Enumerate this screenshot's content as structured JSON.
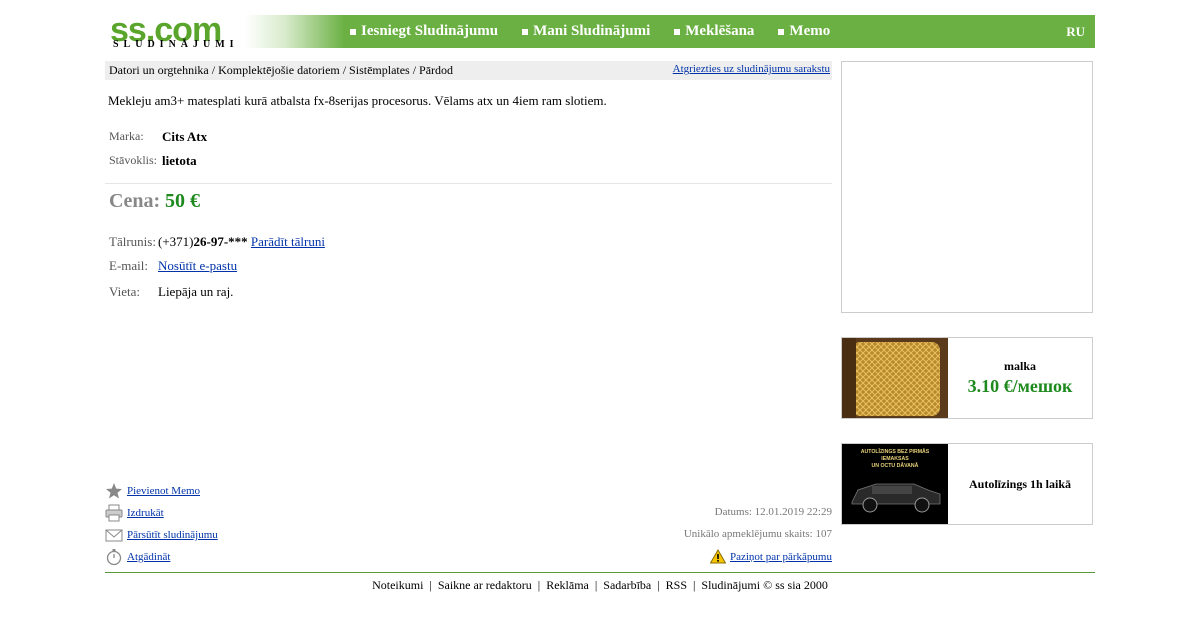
{
  "logo": {
    "main": "ss.com",
    "sub": "SLUDINĀJUMI"
  },
  "nav": [
    {
      "label": "Iesniegt Sludinājumu"
    },
    {
      "label": "Mani Sludinājumi"
    },
    {
      "label": "Meklēšana"
    },
    {
      "label": "Memo"
    }
  ],
  "lang": "RU",
  "breadcrumb": "Datori un orgtehnika / Komplektējošie datoriem / Sistēmplates / Pārdod",
  "back_link": "Atgriezties uz sludinājumu sarakstu",
  "description": "Mekleju am3+ matesplati kurā atbalsta fx-8serijas procesorus. Vēlams atx un 4iem ram slotiem.",
  "attributes": [
    {
      "label": "Marka:",
      "value": "Cits Atx"
    },
    {
      "label": "Stāvoklis:",
      "value": "lietota"
    }
  ],
  "price": {
    "label": "Cena:",
    "value": "50 €"
  },
  "contact": {
    "phone_label": "Tālrunis:",
    "phone_prefix": "(+371)",
    "phone_masked": "26-97-***",
    "phone_show": "Parādīt tālruni",
    "email_label": "E-mail:",
    "email_link": "Nosūtīt e-pastu",
    "place_label": "Vieta:",
    "place_value": "Liepāja un raj."
  },
  "actions": [
    {
      "label": "Pievienot Memo",
      "icon": "star-icon"
    },
    {
      "label": "Izdrukāt",
      "icon": "printer-icon"
    },
    {
      "label": "Pārsūtīt sludinājumu",
      "icon": "envelope-icon"
    },
    {
      "label": "Atgādināt",
      "icon": "timer-icon"
    }
  ],
  "meta": {
    "date": "Datums: 12.01.2019 22:29",
    "views": "Unikālo apmeklējumu skaits: 107",
    "report": "Paziņot par pārkāpumu"
  },
  "footer": [
    "Noteikumi",
    "Saikne ar redaktoru",
    "Reklāma",
    "Sadarbība",
    "RSS",
    "Sludinājumi © ss sia 2000"
  ],
  "promos": [
    {
      "title": "malka",
      "price": "3.10 €/мешок"
    },
    {
      "title": "Autolīzings 1h laikā",
      "image_text_1": "AUTOLĪZINGS BEZ PIRMĀS",
      "image_text_2": "IEMAKSAS",
      "image_text_3": "UN OCTU DĀVANĀ"
    }
  ],
  "colors": {
    "brand_green": "#6ab042",
    "price_green": "#1e8a1e",
    "link_blue": "#0033aa"
  }
}
